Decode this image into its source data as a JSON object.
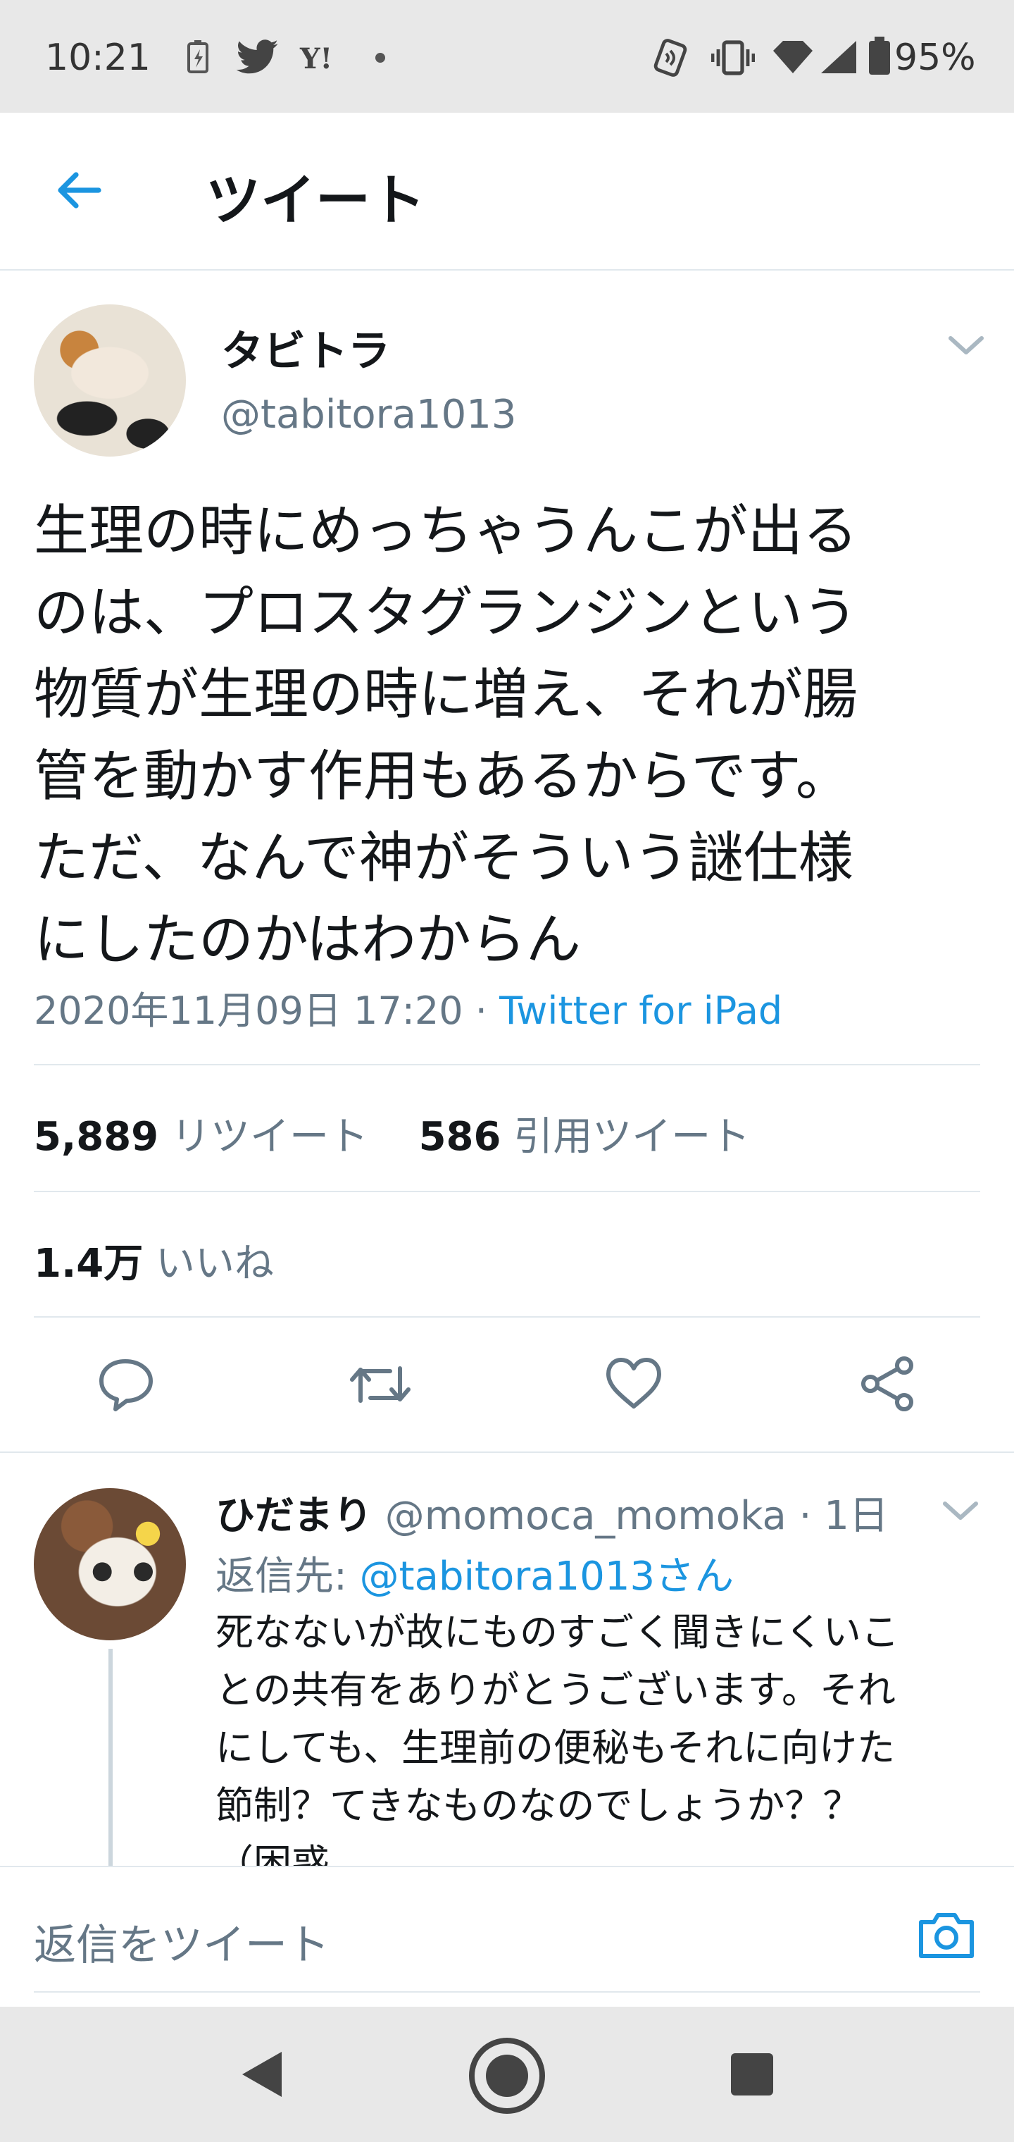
{
  "status_bar": {
    "time": "10:21",
    "battery": "95%",
    "icons": [
      "battery-saver-icon",
      "twitter-bird-icon",
      "yahoo-icon",
      "dot-icon",
      "nfc-icon",
      "vibrate-icon",
      "wifi-icon",
      "signal-icon",
      "battery-icon"
    ]
  },
  "header": {
    "back_icon": "back-arrow-icon",
    "title": "ツイート"
  },
  "tweet": {
    "display_name": "タビトラ",
    "handle": "@tabitora1013",
    "text_lines": [
      "生理の時にめっちゃうんこが出る",
      "のは、プロスタグランジンという",
      "物質が生理の時に増え、それが腸",
      "管を動かす作用もあるからです。",
      "ただ、なんで神がそういう謎仕様",
      "にしたのかはわからん"
    ],
    "timestamp": "2020年11月09日 17:20",
    "separator": " · ",
    "source": "Twitter for iPad"
  },
  "stats": {
    "retweets_count": "5,889",
    "retweets_label": "リツイート",
    "quotes_count": "586",
    "quotes_label": "引用ツイート",
    "likes_count": "1.4万",
    "likes_label": "いいね"
  },
  "actions": [
    "reply-icon",
    "retweet-icon",
    "like-icon",
    "share-icon"
  ],
  "reply": {
    "display_name": "ひだまり",
    "handle": "@momoca_momoka",
    "time": " · 1日",
    "replying_label": "返信先: ",
    "replying_to": "@tabitora1013さん",
    "text_lines": [
      "死なないが故にものすごく聞きにくいこ",
      "との共有をありがとうございます。それ",
      "にしても、生理前の便秘もそれに向けた",
      "節制？てきなものなのでしょうか？？",
      "（困惑"
    ]
  },
  "compose": {
    "placeholder": "返信をツイート",
    "camera_icon": "camera-icon"
  },
  "nav_bar": [
    "back-triangle-icon",
    "home-circle-icon",
    "recents-square-icon"
  ],
  "colors": {
    "accent": "#1b95e0",
    "muted": "#657786",
    "text": "#14171a",
    "divider": "#e1e8ed",
    "system_bar": "#e8e8e8"
  }
}
